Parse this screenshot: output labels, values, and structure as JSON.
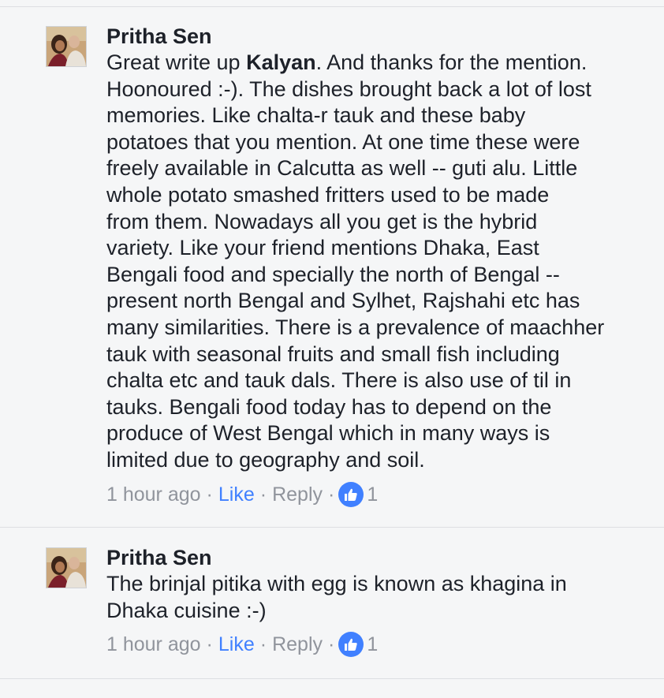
{
  "comments": [
    {
      "author": "Pritha Sen",
      "lines": [
        [
          "Great write up ",
          "Kalyan",
          ". And thanks for the mention."
        ],
        "Hoonoured :-). The dishes brought back a lot of lost",
        "memories. Like chalta-r tauk and these baby",
        "potatoes that you mention. At one time these were",
        "freely available in Calcutta as well -- guti alu. Little",
        "whole potato smashed fritters used to be made",
        "from them. Nowadays all you get is the hybrid",
        "variety. Like your friend mentions Dhaka, East",
        "Bengali food and specially the north of Bengal --",
        "present north Bengal and Sylhet, Rajshahi etc has",
        "many similarities. There is a prevalence of maachher",
        "tauk with seasonal fruits and small fish including",
        "chalta etc and tauk dals. There is also use of til in",
        "tauks. Bengali food today has to depend on the",
        "produce of West Bengal which in many ways is",
        "limited due to geography and soil."
      ],
      "time": "1 hour ago",
      "like_label": "Like",
      "reply_label": "Reply",
      "separator": "·",
      "reaction_count": "1",
      "reaction_icon": "thumbs-up-icon"
    },
    {
      "author": "Pritha Sen",
      "lines": [
        "The brinjal pitika with egg is known as khagina in",
        "Dhaka cuisine :-)"
      ],
      "time": "1 hour ago",
      "like_label": "Like",
      "reply_label": "Reply",
      "separator": "·",
      "reaction_count": "1",
      "reaction_icon": "thumbs-up-icon"
    }
  ],
  "colors": {
    "background": "#f5f6f7",
    "text": "#1d2129",
    "meta": "#90949c",
    "accent": "#4080ff",
    "divider": "#dddfe2"
  }
}
